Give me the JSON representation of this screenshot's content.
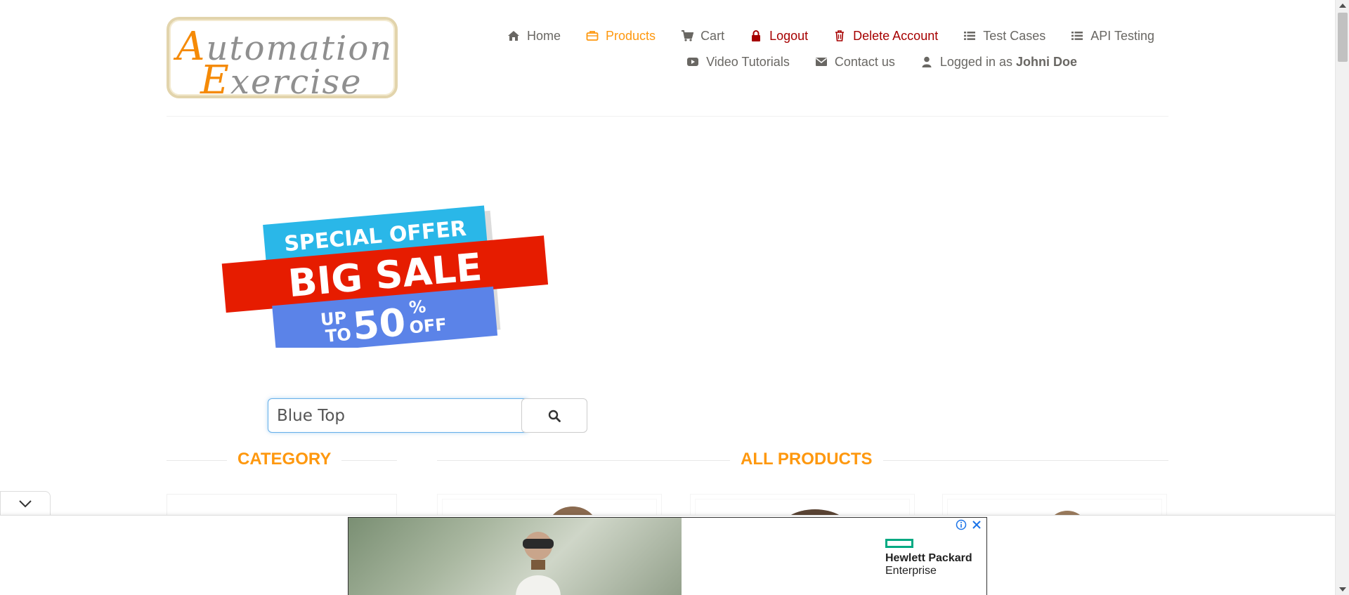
{
  "logo": {
    "line1_cap": "A",
    "line1_rest": "utomation",
    "line2_cap": "E",
    "line2_rest": "xercise"
  },
  "nav": {
    "row1": [
      {
        "label": "Home",
        "icon": "home-icon",
        "style": "normal"
      },
      {
        "label": "Products",
        "icon": "briefcase-icon",
        "style": "active"
      },
      {
        "label": "Cart",
        "icon": "cart-icon",
        "style": "normal"
      },
      {
        "label": "Logout",
        "icon": "lock-icon",
        "style": "red"
      },
      {
        "label": "Delete Account",
        "icon": "trash-icon",
        "style": "red"
      },
      {
        "label": "Test Cases",
        "icon": "list-icon",
        "style": "normal"
      },
      {
        "label": "API Testing",
        "icon": "list-icon",
        "style": "normal"
      }
    ],
    "row2": [
      {
        "label": "Video Tutorials",
        "icon": "youtube-icon"
      },
      {
        "label": "Contact us",
        "icon": "envelope-icon"
      }
    ],
    "logged_in_prefix": "Logged in as",
    "logged_in_user": "Johni Doe"
  },
  "banner": {
    "line1": "SPECIAL OFFER",
    "line2": "BIG SALE",
    "up": "UP",
    "to": "TO",
    "percent_value": "50",
    "percent_sign": "%",
    "off": "OFF"
  },
  "search": {
    "value": "Blue Top",
    "button_icon": "search-icon"
  },
  "sections": {
    "category": "CATEGORY",
    "all_products": "ALL PRODUCTS"
  },
  "ad": {
    "brand_line1": "Hewlett Packard",
    "brand_line2": "Enterprise",
    "info_icon": "info-icon",
    "close_icon": "close-icon"
  },
  "colors": {
    "accent": "#fe980f",
    "danger": "#a60000",
    "text": "#696763",
    "sale_red": "#e61c00",
    "sale_cyan": "#2ab7e8",
    "sale_blue": "#5b83e8",
    "hpe_green": "#01a982"
  }
}
